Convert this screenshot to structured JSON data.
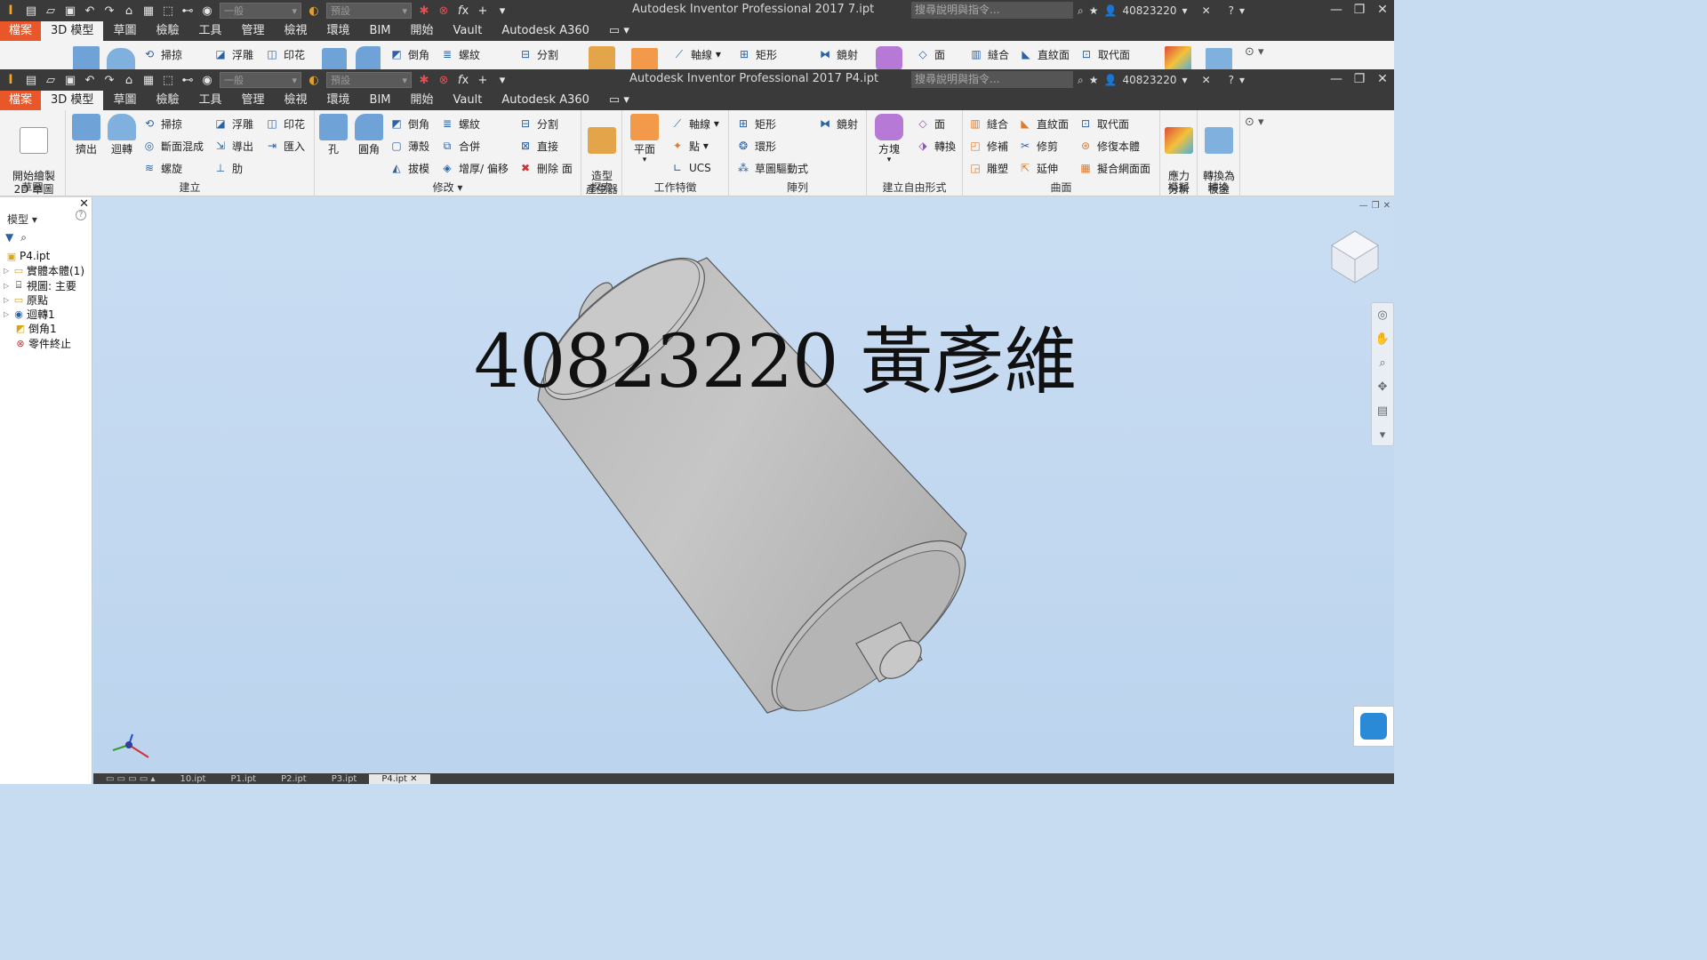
{
  "titlebar_back": {
    "title": "Autodesk Inventor Professional 2017    7.ipt",
    "combo_style": "一般",
    "combo_material": "預設",
    "search_placeholder": "搜尋說明與指令...",
    "user": "40823220"
  },
  "titlebar_front": {
    "title": "Autodesk Inventor Professional 2017    P4.ipt",
    "combo_style": "一般",
    "combo_material": "預設",
    "search_placeholder": "搜尋說明與指令...",
    "user": "40823220"
  },
  "tabs": [
    "檔案",
    "3D 模型",
    "草圖",
    "檢驗",
    "工具",
    "管理",
    "檢視",
    "環境",
    "BIM",
    "開始",
    "Vault",
    "Autodesk A360"
  ],
  "ribbon": {
    "sketch_panel": {
      "title": "草圖",
      "start_2d_sketch": "開始繪製\n2D 草圖"
    },
    "create_panel": {
      "title": "建立",
      "extrude": "擠出",
      "revolve": "迴轉",
      "sweep": "掃掠",
      "loft": "斷面混成",
      "coil": "螺旋",
      "emboss": "浮雕",
      "derive": "導出",
      "rib": "肋",
      "decal": "印花",
      "import": "匯入"
    },
    "modify_panel": {
      "title": "修改",
      "hole": "孔",
      "fillet": "圓角",
      "chamfer": "倒角",
      "shell": "薄殼",
      "draft": "拔模",
      "thread": "螺紋",
      "combine": "合併",
      "thicken": "增厚/ 偏移",
      "split": "分割",
      "direct": "直接",
      "delete_face": "刪除 面"
    },
    "explore_panel": {
      "title": "探索",
      "shape_generator": "造型\n產生器"
    },
    "work_features_panel": {
      "title": "工作特徵",
      "plane": "平面",
      "axis": "軸線",
      "point": "點",
      "ucs": "UCS"
    },
    "pattern_panel": {
      "title": "陣列",
      "rectangular": "矩形",
      "circular": "環形",
      "sketch_driven": "草圖驅動式",
      "mirror": "鏡射"
    },
    "freeform_panel": {
      "title": "建立自由形式",
      "box": "方塊",
      "face": "面",
      "convert": "轉換"
    },
    "surface_panel": {
      "title": "曲面",
      "stitch": "縫合",
      "patch": "修補",
      "sculpt": "雕塑",
      "ruled": "直紋面",
      "trim": "修剪",
      "extend": "延伸",
      "replace_face": "取代面",
      "repair_bodies": "修復本體",
      "fit_mesh_face": "擬合網面面"
    },
    "simulation_panel": {
      "title": "模擬",
      "stress_analysis": "應力\n分析"
    },
    "convert_panel": {
      "title": "轉換",
      "sheet_metal": "轉換為\n板金"
    }
  },
  "browser": {
    "header": "模型",
    "items": [
      {
        "label": "P4.ipt",
        "indent": 0,
        "expandable": false
      },
      {
        "label": "實體本體(1)",
        "indent": 0,
        "expandable": true
      },
      {
        "label": "視圖: 主要",
        "indent": 0,
        "expandable": true
      },
      {
        "label": "原點",
        "indent": 0,
        "expandable": true
      },
      {
        "label": "迴轉1",
        "indent": 0,
        "expandable": true
      },
      {
        "label": "倒角1",
        "indent": 1,
        "expandable": false
      },
      {
        "label": "零件終止",
        "indent": 1,
        "expandable": false
      }
    ]
  },
  "viewport": {
    "overlay_text": "40823220 黃彥維"
  },
  "doc_tabs": [
    "10.ipt",
    "P1.ipt",
    "P2.ipt",
    "P3.ipt",
    "P4.ipt"
  ],
  "colors": {
    "titlebar": "#3a3a3a",
    "file_tab": "#e8562a",
    "ribbon": "#f3f3f3",
    "viewport": "#c7dcf0",
    "model_gray": "#bdbdbd"
  }
}
